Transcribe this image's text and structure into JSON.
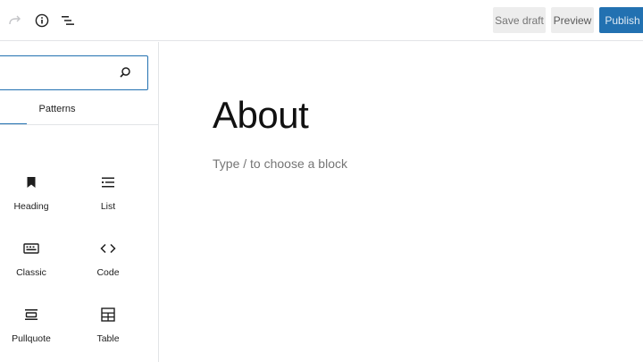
{
  "toolbar": {
    "icons": [
      "redo-icon",
      "info-icon",
      "list-view-icon"
    ],
    "save_draft_label": "Save draft",
    "preview_label": "Preview",
    "publish_label": "Publish",
    "colors": {
      "publish_bg": "#2271b1",
      "secondary_bg": "#ededed"
    }
  },
  "sidebar": {
    "search": {
      "value": "",
      "placeholder": ""
    },
    "tabs": [
      {
        "label": "Patterns"
      }
    ],
    "blocks": [
      {
        "label": "Heading",
        "icon": "bookmark-icon"
      },
      {
        "label": "List",
        "icon": "list-icon"
      },
      {
        "label": "Classic",
        "icon": "keyboard-icon"
      },
      {
        "label": "Code",
        "icon": "code-icon"
      },
      {
        "label": "Pullquote",
        "icon": "pullquote-icon"
      },
      {
        "label": "Table",
        "icon": "table-icon"
      }
    ]
  },
  "editor": {
    "title": "About",
    "placeholder": "Type / to choose a block"
  }
}
